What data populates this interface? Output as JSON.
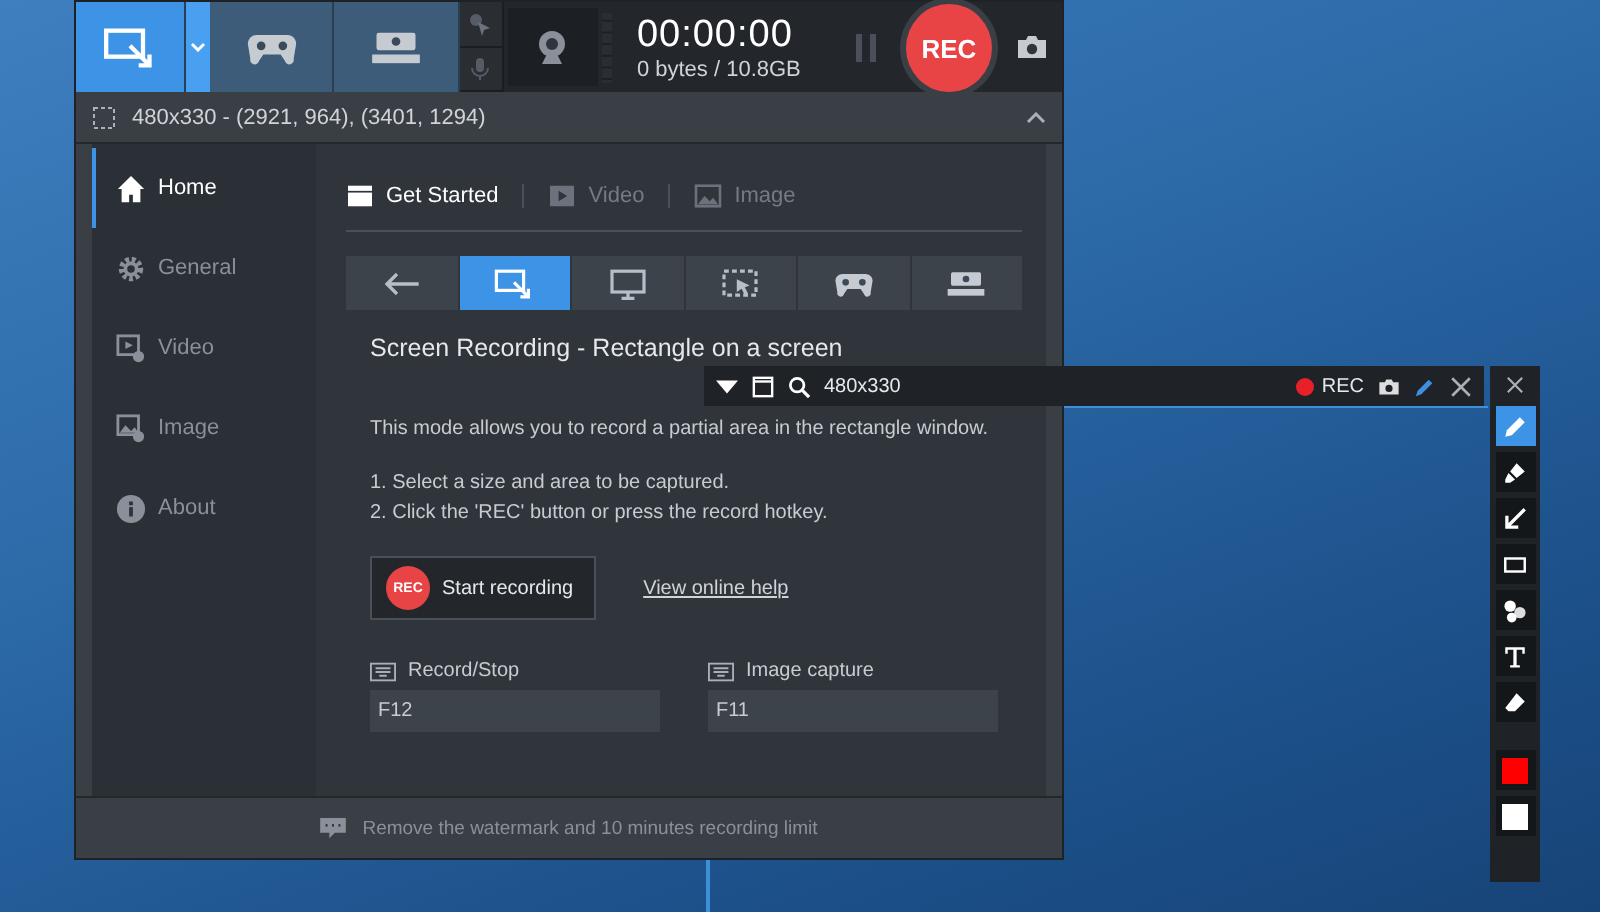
{
  "toolbar": {
    "modes": [
      {
        "kind": "rectangle",
        "selected": true
      },
      {
        "kind": "game",
        "selected": false
      },
      {
        "kind": "hdmi",
        "selected": false
      }
    ],
    "timer": "00:00:00",
    "size": "0 bytes / 10.8GB",
    "rec_button": "REC"
  },
  "region_bar": {
    "label": "480x330 - (2921, 964), (3401, 1294)"
  },
  "sidebar": {
    "items": [
      {
        "kind": "home",
        "label": "Home",
        "selected": true
      },
      {
        "kind": "general",
        "label": "General",
        "selected": false
      },
      {
        "kind": "video",
        "label": "Video",
        "selected": false
      },
      {
        "kind": "image",
        "label": "Image",
        "selected": false
      },
      {
        "kind": "about",
        "label": "About",
        "selected": false
      }
    ]
  },
  "tabs": [
    {
      "kind": "start",
      "label": "Get Started",
      "selected": true
    },
    {
      "kind": "video",
      "label": "Video",
      "selected": false
    },
    {
      "kind": "image",
      "label": "Image",
      "selected": false
    }
  ],
  "mode_buttons": [
    {
      "kind": "back",
      "selected": false
    },
    {
      "kind": "rectangle",
      "selected": true
    },
    {
      "kind": "fullscreen",
      "selected": false
    },
    {
      "kind": "mouse",
      "selected": false
    },
    {
      "kind": "game",
      "selected": false
    },
    {
      "kind": "hdmi",
      "selected": false
    }
  ],
  "content": {
    "title": "Screen Recording - Rectangle on a screen",
    "description": "This mode allows you to record a partial area in the rectangle window.",
    "steps": [
      "1. Select a size and area to be captured.",
      "2. Click the 'REC' button or press the record hotkey."
    ],
    "start_button": {
      "badge": "REC",
      "label": "Start recording"
    },
    "help_link": "View online help",
    "hotkeys": [
      {
        "label": "Record/Stop",
        "value": "F12"
      },
      {
        "label": "Image capture",
        "value": "F11"
      }
    ]
  },
  "status_bar": "Remove the watermark and 10 minutes recording limit",
  "capture_toolbar": {
    "size": "480x330",
    "rec_label": "REC"
  },
  "draw_tools": [
    {
      "kind": "pen",
      "selected": true
    },
    {
      "kind": "highlighter",
      "selected": false
    },
    {
      "kind": "arrow",
      "selected": false
    },
    {
      "kind": "rectangle",
      "selected": false
    },
    {
      "kind": "numbers",
      "selected": false
    },
    {
      "kind": "text",
      "selected": false
    },
    {
      "kind": "eraser",
      "selected": false
    }
  ],
  "draw_colors": [
    {
      "color": "#ff0000"
    },
    {
      "color": "#ffffff"
    }
  ]
}
